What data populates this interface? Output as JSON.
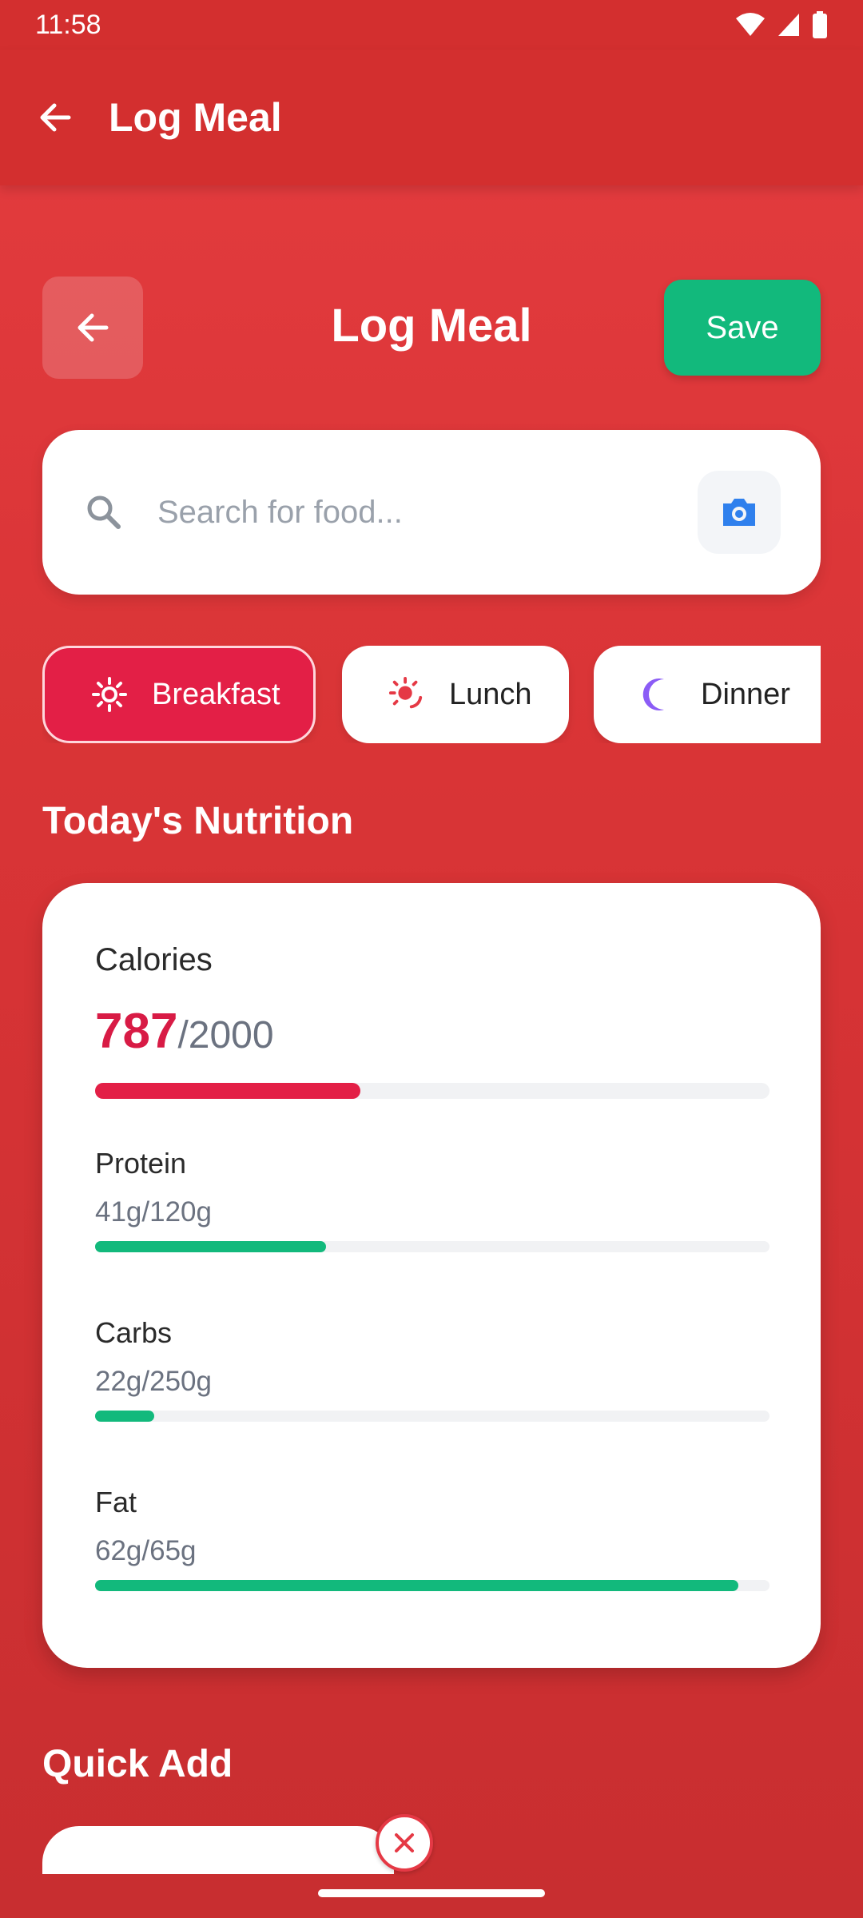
{
  "status_bar": {
    "time": "11:58"
  },
  "app_bar": {
    "title": "Log Meal",
    "back_icon": "arrow-left-icon"
  },
  "header": {
    "title": "Log Meal",
    "save_label": "Save"
  },
  "search": {
    "placeholder": "Search for food...",
    "search_icon": "search-icon",
    "camera_icon": "camera-icon"
  },
  "meal_types": [
    {
      "label": "Breakfast",
      "icon": "sunrise-icon",
      "active": true
    },
    {
      "label": "Lunch",
      "icon": "sun-icon",
      "active": false
    },
    {
      "label": "Dinner",
      "icon": "moon-icon",
      "active": false
    }
  ],
  "nutrition": {
    "section_title": "Today's Nutrition",
    "calories": {
      "label": "Calories",
      "current": "787",
      "goal": "/2000",
      "progress": 0.3935,
      "color": "#e31f46"
    },
    "macros": [
      {
        "label": "Protein",
        "value": "41g/120g",
        "progress": 0.342,
        "color": "#12b97c"
      },
      {
        "label": "Carbs",
        "value": "22g/250g",
        "progress": 0.088,
        "color": "#12b97c"
      },
      {
        "label": "Fat",
        "value": "62g/65g",
        "progress": 0.954,
        "color": "#12b97c"
      }
    ]
  },
  "quick_add": {
    "section_title": "Quick Add"
  },
  "colors": {
    "primary": "#d32f2f",
    "accent_green": "#12b97c",
    "accent_pink": "#e31f46",
    "camera_blue": "#2f80ed"
  }
}
